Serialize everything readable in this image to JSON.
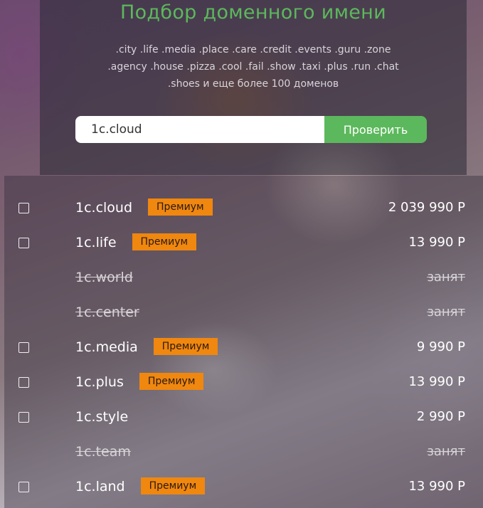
{
  "hero": {
    "title": "Подбор доменного имени",
    "zones_line1": ".city .life .media .place .care .credit .events .guru .zone",
    "zones_line2": ".agency .house .pizza .cool .fail .show .taxi .plus .run .chat",
    "zones_line3": ".shoes и еще более 100 доменов"
  },
  "search": {
    "value": "1c.cloud",
    "button_label": "Проверить"
  },
  "colors": {
    "accent_green": "#5cb85c",
    "premium_badge": "#f0870f"
  },
  "results": [
    {
      "domain": "1c.cloud",
      "badge": "Премиум",
      "price": "2 039 990 Р",
      "taken": false
    },
    {
      "domain": "1c.life",
      "badge": "Премиум",
      "price": "13 990 Р",
      "taken": false
    },
    {
      "domain": "1c.world",
      "badge": "",
      "price": "занят",
      "taken": true
    },
    {
      "domain": "1c.center",
      "badge": "",
      "price": "занят",
      "taken": true
    },
    {
      "domain": "1c.media",
      "badge": "Премиум",
      "price": "9 990 Р",
      "taken": false
    },
    {
      "domain": "1c.plus",
      "badge": "Премиум",
      "price": "13 990 Р",
      "taken": false
    },
    {
      "domain": "1c.style",
      "badge": "",
      "price": "2 990 Р",
      "taken": false
    },
    {
      "domain": "1c.team",
      "badge": "",
      "price": "занят",
      "taken": true
    },
    {
      "domain": "1c.land",
      "badge": "Премиум",
      "price": "13 990 Р",
      "taken": false
    }
  ]
}
